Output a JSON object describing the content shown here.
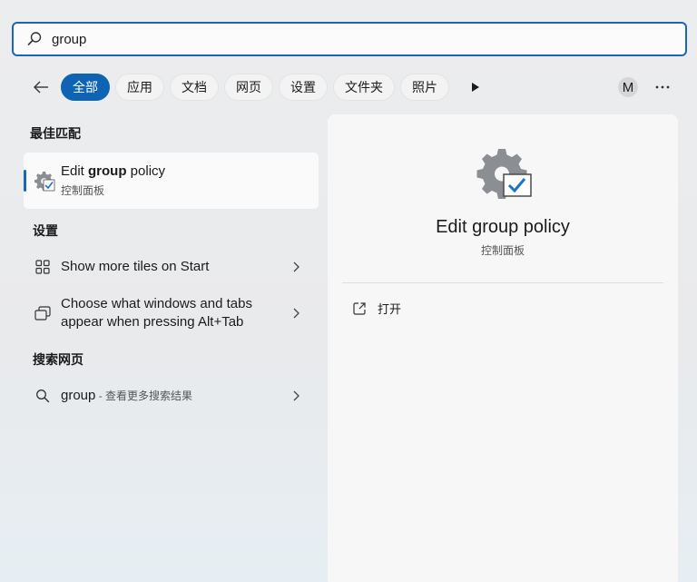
{
  "search": {
    "value": "group",
    "placeholder": ""
  },
  "filters": {
    "items": [
      "全部",
      "应用",
      "文档",
      "网页",
      "设置",
      "文件夹",
      "照片"
    ],
    "active_index": 0
  },
  "account": {
    "initial": "M"
  },
  "best_match": {
    "heading": "最佳匹配",
    "title_prefix": "Edit ",
    "title_bold": "group",
    "title_suffix": " policy",
    "subtitle": "控制面板",
    "icon": "control-panel-gear-icon"
  },
  "settings": {
    "heading": "设置",
    "items": [
      {
        "label": "Show more tiles on Start",
        "icon": "tiles-icon"
      },
      {
        "label_line1": "Choose what windows and tabs",
        "label_line2": "appear when pressing Alt+Tab",
        "icon": "windows-tabs-icon"
      }
    ]
  },
  "web": {
    "heading": "搜索网页",
    "query": "group",
    "hint": " - 查看更多搜索结果",
    "icon": "search-icon"
  },
  "detail": {
    "title": "Edit group policy",
    "subtitle": "控制面板",
    "action_open": "打开"
  },
  "colors": {
    "accent": "#0e64b3",
    "focus_border": "#1a67b8"
  }
}
